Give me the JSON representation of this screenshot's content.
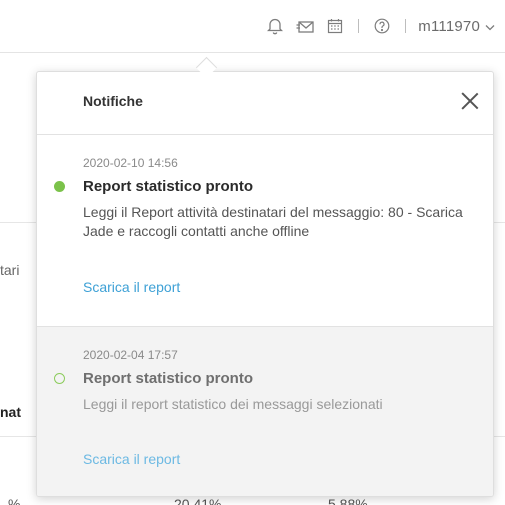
{
  "topbar": {
    "icons": [
      "bell-icon",
      "mail-icon",
      "calendar-icon",
      "help-icon"
    ],
    "username": "m111970"
  },
  "background": {
    "fragment_1": "tari",
    "fragment_2": "nat",
    "value_1": "20,41%",
    "value_2": "5,88%",
    "value_3": "%"
  },
  "notifications": {
    "title": "Notifiche",
    "items": [
      {
        "date": "2020-02-10 14:56",
        "title": "Report statistico pronto",
        "body": "Leggi il Report attività destinatari del messaggio: 80 - Scarica Jade e raccogli contatti anche offline",
        "link": "Scarica il report",
        "state": "unread",
        "dot_color": "#7bc24a"
      },
      {
        "date": "2020-02-04 17:57",
        "title": "Report statistico pronto",
        "body": "Leggi il report statistico dei messaggi selezionati",
        "link": "Scarica il report",
        "state": "read",
        "dot_color": "#8ccc5c"
      }
    ]
  },
  "colors": {
    "link": "#3ea1d6",
    "unread_dot": "#7bc24a",
    "read_background": "#f3f3f3"
  }
}
